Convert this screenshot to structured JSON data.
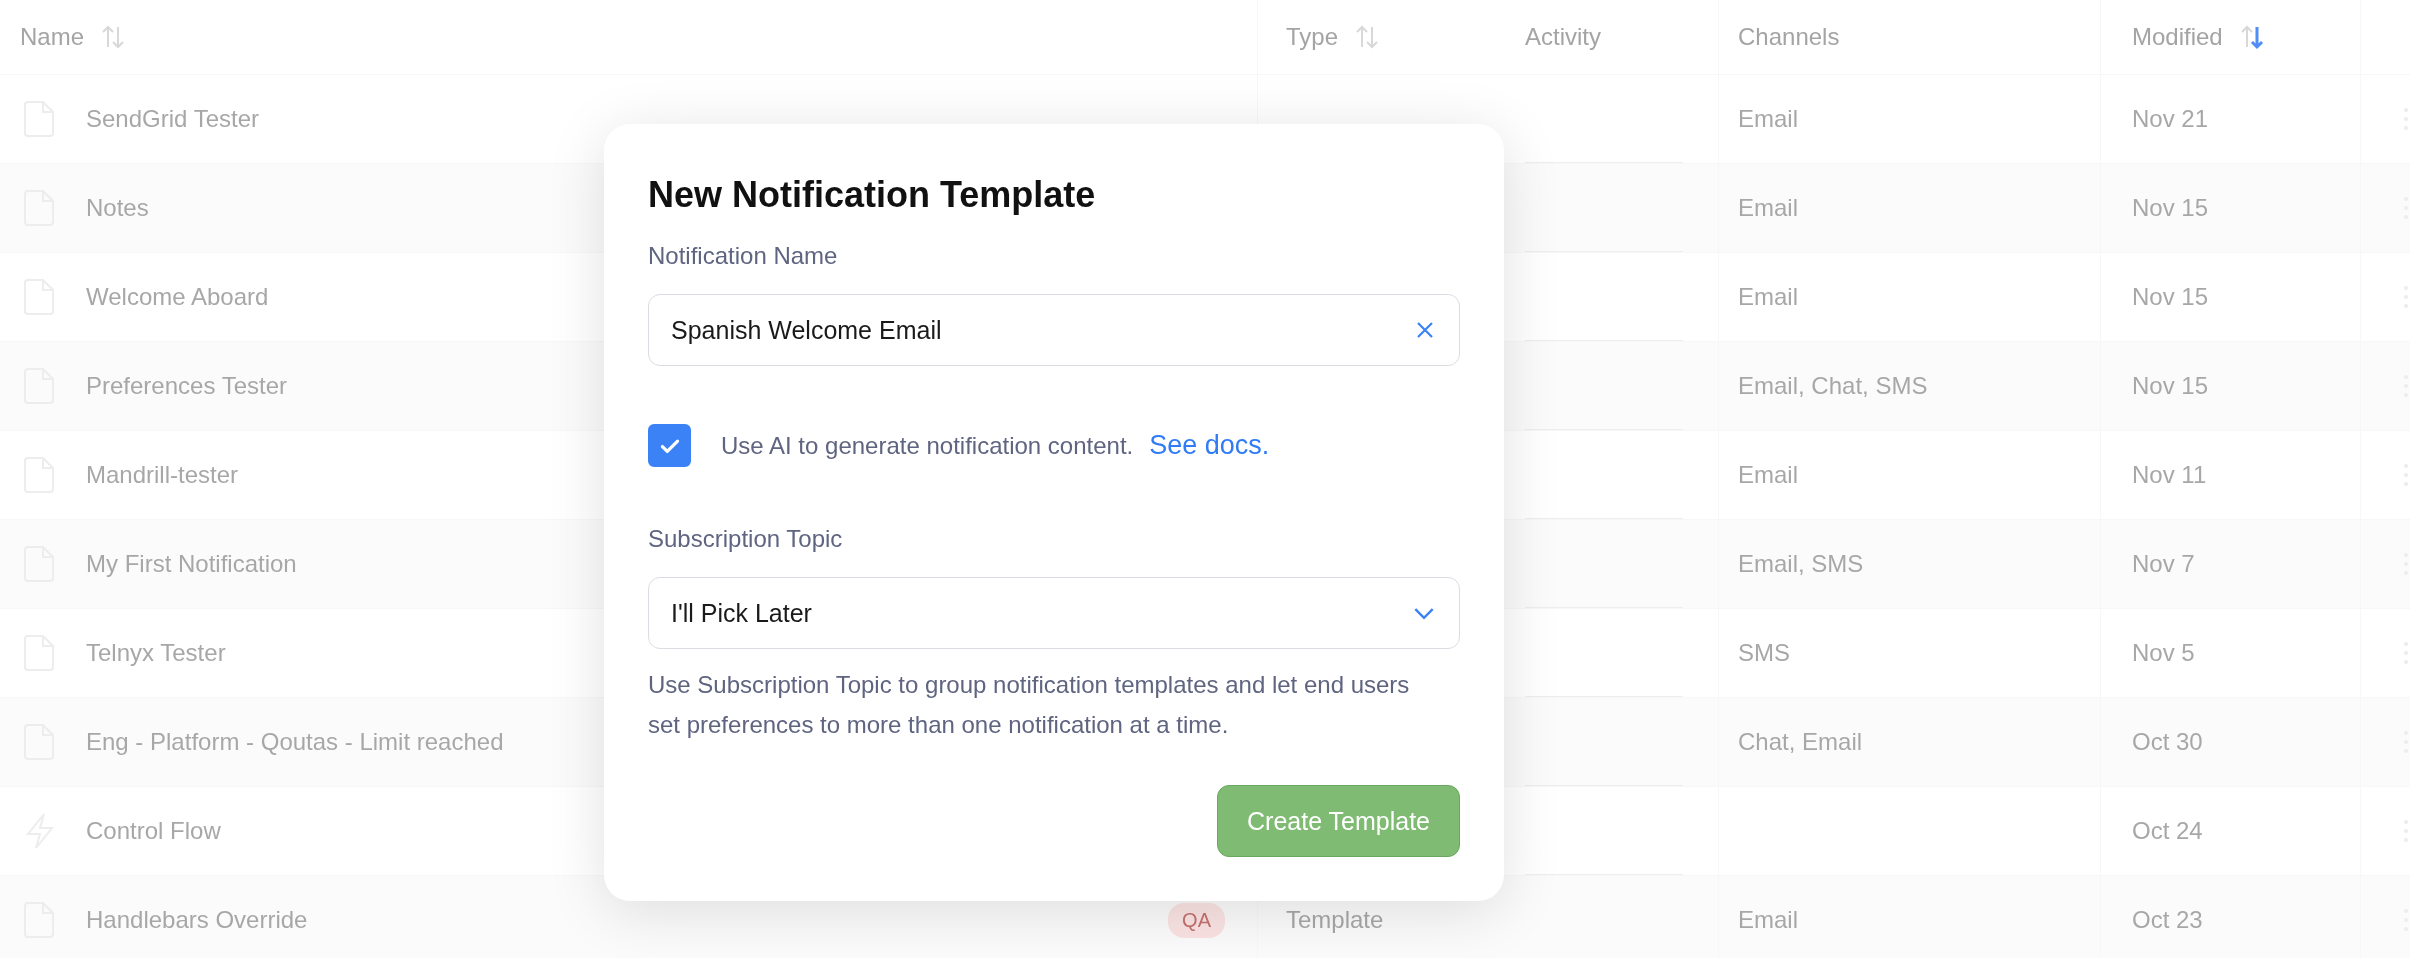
{
  "table": {
    "columns": [
      {
        "label": "Name",
        "sortable": true,
        "sorted": false
      },
      {
        "label": "Type",
        "sortable": true,
        "sorted": false
      },
      {
        "label": "Activity",
        "sortable": false
      },
      {
        "label": "Channels",
        "sortable": false
      },
      {
        "label": "Modified",
        "sortable": true,
        "sorted": true
      }
    ],
    "rows": [
      {
        "kind": "document",
        "name": "SendGrid Tester",
        "channels": "Email",
        "modified": "Nov 21"
      },
      {
        "kind": "document",
        "name": "Notes",
        "channels": "Email",
        "modified": "Nov 15"
      },
      {
        "kind": "document",
        "name": "Welcome Aboard",
        "channels": "Email",
        "modified": "Nov 15"
      },
      {
        "kind": "document",
        "name": "Preferences Tester",
        "channels": "Email, Chat, SMS",
        "modified": "Nov 15"
      },
      {
        "kind": "document",
        "name": "Mandrill-tester",
        "channels": "Email",
        "modified": "Nov 11"
      },
      {
        "kind": "document",
        "name": "My First Notification",
        "channels": "Email, SMS",
        "modified": "Nov 7"
      },
      {
        "kind": "document",
        "name": "Telnyx Tester",
        "channels": "SMS",
        "modified": "Nov 5"
      },
      {
        "kind": "document",
        "name": "Eng - Platform - Qoutas - Limit reached",
        "channels": "Chat, Email",
        "modified": "Oct 30"
      },
      {
        "kind": "flow",
        "name": "Control Flow",
        "modified": "Oct 24"
      },
      {
        "kind": "document",
        "name": "Handlebars Override",
        "tag": "QA",
        "type": "Template",
        "channels": "Email",
        "modified": "Oct 23"
      }
    ]
  },
  "modal": {
    "title": "New Notification Template",
    "name_field": {
      "label": "Notification Name",
      "value": "Spanish Welcome Email"
    },
    "ai_option": {
      "label": "Use AI to generate notification content.",
      "link": "See docs.",
      "checked": true
    },
    "topic_field": {
      "label": "Subscription Topic",
      "value": "I'll Pick Later",
      "help": "Use Subscription Topic to group notification templates and let end users set preferences to more than one notification at a time."
    },
    "button": "Create Template"
  }
}
